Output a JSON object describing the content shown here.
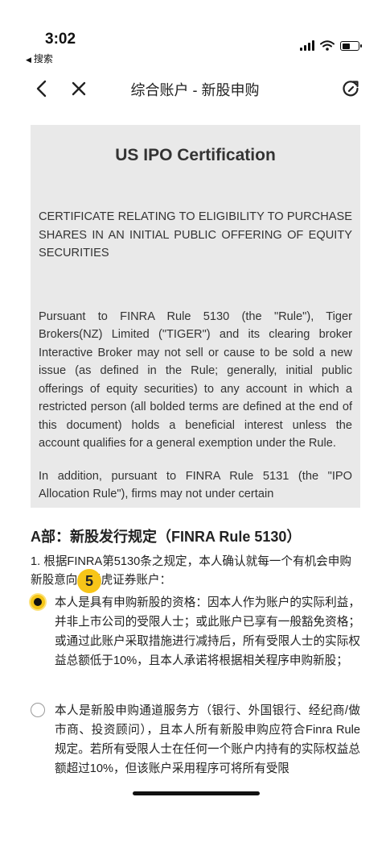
{
  "status_bar": {
    "time": "3:02",
    "back_app": "搜索",
    "icons": [
      "signal-icon",
      "wifi-icon",
      "battery-icon"
    ]
  },
  "navbar": {
    "title": "综合账户 - 新股申购",
    "icons": [
      "back-icon",
      "close-icon",
      "refresh-icon"
    ]
  },
  "certificate": {
    "title": "US IPO Certification",
    "paragraphs": [
      "CERTIFICATE RELATING TO ELIGIBILITY TO PURCHASE SHARES IN AN INITIAL PUBLIC OFFERING OF EQUITY SECURITIES",
      "Pursuant to FINRA Rule 5130 (the \"Rule\"), Tiger Brokers(NZ) Limited (\"TIGER\") and its clearing broker Interactive Broker may not sell or cause to be sold a new issue (as defined in the Rule; generally, initial public offerings of equity securities) to any account in which a restricted person (all bolded terms are defined at the end of this document) holds a beneficial interest unless the account qualifies for a general exemption under the Rule.",
      "In addition, pursuant to FINRA Rule 5131 (the \"IPO Allocation Rule\"), firms may not under certain"
    ]
  },
  "section_a": {
    "title": "A部：新股发行规定（FINRA Rule 5130）",
    "clause": "1. 根据FINRA第5130条之规定，本人确认就每一个有机会申购新股意向的老虎证券账户：",
    "options": [
      {
        "text": "本人是具有申购新股的资格：因本人作为账户的实际利益，并非上市公司的受限人士；或此账户已享有一般豁免资格；或通过此账户采取措施进行减持后，所有受限人士的实际权益总额低于10%，且本人承诺将根据相关程序申购新股；",
        "checked": true
      },
      {
        "text": "本人是新股申购通道服务方（银行、外国银行、经纪商/做市商、投资顾问），且本人所有新股申购应符合Finra Rule规定。若所有受限人士在任何一个账户内持有的实际权益总额超过10%，但该账户采用程序可将所有受限",
        "checked": false
      }
    ]
  },
  "step_badge": "5",
  "colors": {
    "accent": "#f7c519",
    "panel_bg": "#e9e9e9",
    "text": "#222222"
  }
}
